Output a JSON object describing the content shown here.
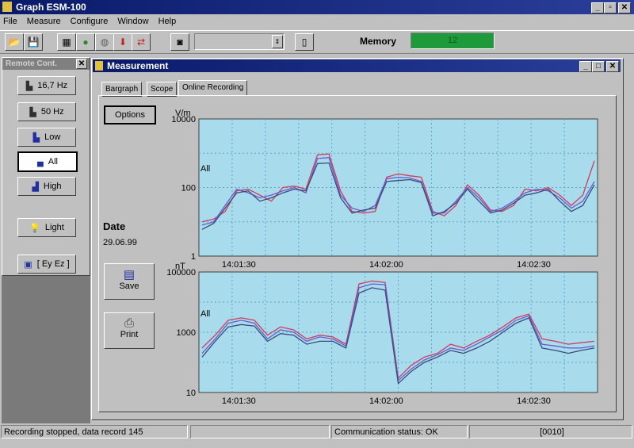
{
  "app": {
    "title": "Graph ESM-100"
  },
  "menu": [
    "File",
    "Measure",
    "Configure",
    "Window",
    "Help"
  ],
  "toolbar": {
    "memory_label": "Memory",
    "memory_value": "12",
    "memory_color": "#1f9a3a"
  },
  "remote_control": {
    "title": "Remote Cont.",
    "buttons": [
      "16,7 Hz",
      "50 Hz",
      "Low",
      "All",
      "High"
    ],
    "light": "Light",
    "eyez": "[ Ey Ez ]"
  },
  "measurement": {
    "title": "Measurement",
    "tabs": [
      "Bargraph",
      "Scope",
      "Online Recording"
    ],
    "active_tab": "Online Recording",
    "options_button": "Options",
    "date_label": "Date",
    "date_value": "29.06.99",
    "save_button": "Save",
    "print_button": "Print"
  },
  "status_bar": {
    "message": "Recording stopped, data record 145",
    "comm": "Communication status: OK",
    "code": "[0010]"
  },
  "colors": {
    "plot_bg": "#a8dcec",
    "grid": "#5aa6c8",
    "series": [
      "#d43a5a",
      "#6a5acd",
      "#3a4a7a",
      "#8ab0a8",
      "#c86ab0"
    ]
  },
  "chart_data": [
    {
      "type": "line",
      "ylabel": "V/m",
      "yscale": "log",
      "ylim": [
        1,
        10000
      ],
      "yticks": [
        "10000",
        "100",
        "1"
      ],
      "x_ticks": [
        "14:01:30",
        "14:02:00",
        "14:02:30"
      ],
      "series_label": "All",
      "series": [
        {
          "values": [
            10,
            12,
            20,
            80,
            90,
            60,
            40,
            100,
            110,
            90,
            900,
            950,
            80,
            20,
            18,
            20,
            200,
            250,
            220,
            200,
            20,
            15,
            30,
            120,
            60,
            22,
            20,
            30,
            90,
            80,
            100,
            60,
            30,
            60,
            600
          ]
        },
        {
          "values": [
            8,
            10,
            30,
            90,
            70,
            50,
            60,
            80,
            100,
            70,
            700,
            750,
            60,
            25,
            20,
            30,
            180,
            200,
            190,
            150,
            18,
            18,
            40,
            100,
            50,
            20,
            25,
            40,
            70,
            90,
            80,
            50,
            25,
            40,
            150
          ]
        },
        {
          "values": [
            6,
            9,
            25,
            70,
            80,
            40,
            50,
            70,
            90,
            80,
            500,
            520,
            50,
            18,
            22,
            25,
            150,
            160,
            170,
            140,
            15,
            20,
            35,
            90,
            40,
            18,
            22,
            35,
            60,
            70,
            90,
            40,
            20,
            30,
            120
          ]
        }
      ]
    },
    {
      "type": "line",
      "ylabel": "nT",
      "yscale": "log",
      "ylim": [
        10,
        100000
      ],
      "yticks": [
        "100000",
        "1000",
        "10"
      ],
      "x_ticks": [
        "14:01:30",
        "14:02:00",
        "14:02:30"
      ],
      "series_label": "All",
      "series": [
        {
          "values": [
            300,
            800,
            2500,
            3000,
            2500,
            800,
            1500,
            1200,
            600,
            800,
            700,
            400,
            40000,
            50000,
            45000,
            30,
            80,
            150,
            200,
            400,
            300,
            500,
            800,
            1500,
            3000,
            4000,
            600,
            500,
            400,
            450,
            500
          ]
        },
        {
          "values": [
            200,
            600,
            2000,
            2500,
            2000,
            600,
            1200,
            1000,
            500,
            700,
            600,
            350,
            30000,
            40000,
            38000,
            25,
            60,
            120,
            180,
            300,
            250,
            400,
            700,
            1200,
            2500,
            3500,
            400,
            350,
            300,
            300,
            350
          ]
        },
        {
          "values": [
            150,
            500,
            1500,
            1800,
            1600,
            500,
            900,
            800,
            400,
            500,
            500,
            300,
            20000,
            30000,
            25000,
            20,
            50,
            100,
            150,
            250,
            200,
            300,
            500,
            1000,
            2000,
            3000,
            300,
            250,
            200,
            250,
            300
          ]
        }
      ]
    }
  ]
}
